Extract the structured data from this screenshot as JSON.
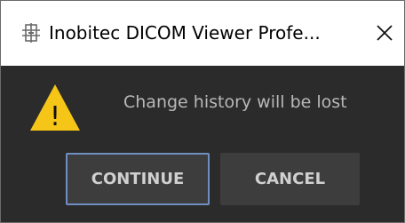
{
  "window": {
    "title": "Inobitec DICOM Viewer Profe...",
    "app_icon": "inobitec-app-icon",
    "close_icon": "close-icon"
  },
  "dialog": {
    "message": "Change history will be lost",
    "icon": "warning-icon",
    "icon_glyph": "!",
    "buttons": {
      "continue_label": "CONTINUE",
      "cancel_label": "CANCEL"
    }
  },
  "colors": {
    "background": "#2b2b2b",
    "button": "#3d3d3d",
    "focus_border": "#6f8fc2",
    "warning": "#f5c518",
    "text": "#b8b8b8"
  }
}
